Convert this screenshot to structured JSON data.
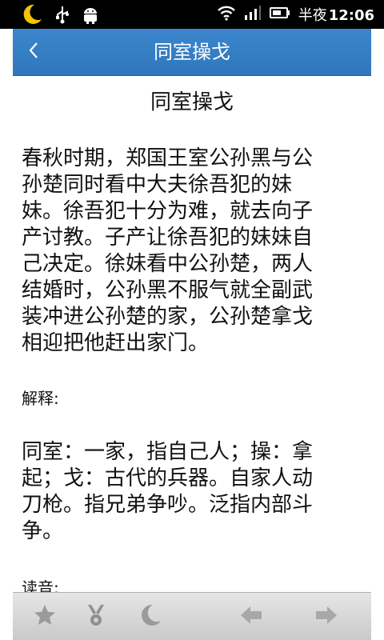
{
  "status_bar": {
    "period": "半夜",
    "time": "12:06",
    "icons": [
      "moon-icon",
      "usb-icon",
      "android-icon",
      "wifi-icon",
      "signal-icon",
      "battery-icon"
    ]
  },
  "header": {
    "title": "同室操戈",
    "back_icon": "back-chevron-icon"
  },
  "article": {
    "heading": "同室操戈",
    "story": "春秋时期，郑国王室公孙黑与公孙楚同时看中大夫徐吾犯的妹妹。徐吾犯十分为难，就去向子产讨教。子产让徐吾犯的妹妹自己决定。徐妹看中公孙楚，两人结婚时，公孙黑不服气就全副武装冲进公孙楚的家，公孙楚拿戈相迎把他赶出家门。",
    "explanation_label": "解释:",
    "explanation": "同室：一家，指自己人；操：拿起；戈：古代的兵器。自家人动刀枪。指兄弟争吵。泛指内部斗争。",
    "pronunciation_label": "读音:"
  },
  "toolbar": {
    "buttons": [
      "star-icon",
      "medal-icon",
      "moon-icon",
      "arrow-left-icon",
      "arrow-right-icon"
    ]
  },
  "colors": {
    "titlebar": "#3583c8",
    "toolbar_icon": "#9a9a9a",
    "status_bg": "#000000"
  }
}
